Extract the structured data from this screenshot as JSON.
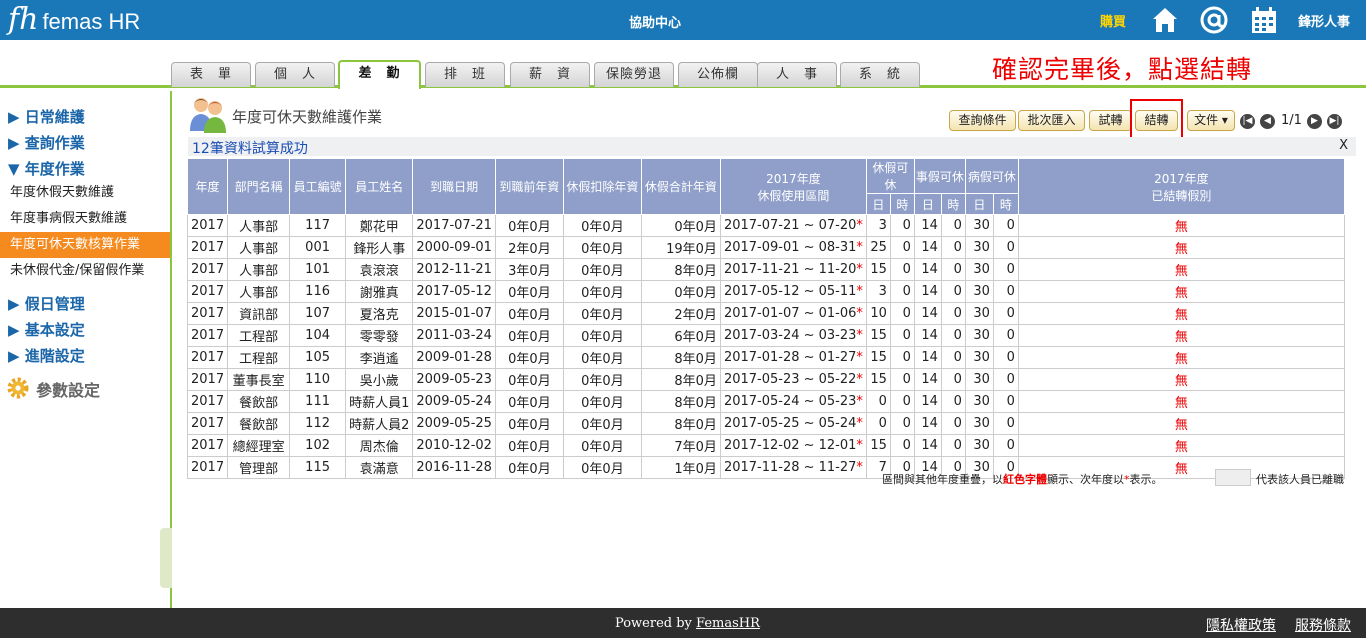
{
  "header": {
    "logo_mark": "fh",
    "logo_text": "femas HR",
    "center_title": "協助中心",
    "buy_label": "購買",
    "user_name": "鋒形人事"
  },
  "tabs": [
    "表　單",
    "個　人",
    "差　勤",
    "排　班",
    "薪　資",
    "保險勞退",
    "公佈欄",
    "人　事",
    "系　統"
  ],
  "annotation": "確認完畢後，點選結轉",
  "sidebar": {
    "groups": [
      "▶ 日常維護",
      "▶ 查詢作業",
      "▼ 年度作業",
      "▶ 假日管理",
      "▶ 基本設定",
      "▶ 進階設定"
    ],
    "items": [
      "年度休假天數維護",
      "年度事病假天數維護",
      "年度可休天數核算作業",
      "未休假代金/保留假作業"
    ],
    "param_label": "參數設定"
  },
  "page": {
    "title": "年度可休天數維護作業",
    "buttons": {
      "query": "查詢條件",
      "import": "批次匯入",
      "trial": "試轉",
      "carry": "結轉",
      "doc": "文件 ▾"
    },
    "pager": {
      "first": "|◀",
      "prev": "◀",
      "info": "1/1",
      "next": "▶",
      "last": "▶|"
    },
    "message": "12筆資料試算成功",
    "close": "X"
  },
  "table": {
    "headers": {
      "year": "年度",
      "dept": "部門名稱",
      "emp_no": "員工編號",
      "emp_name": "員工姓名",
      "join_date": "到職日期",
      "prior_years": "到職前年資",
      "leave_deduct": "休假扣除年資",
      "leave_total": "休假合計年資",
      "period_line1": "2017年度",
      "period_line2": "休假使用區間",
      "annual": "休假可休",
      "personal": "事假可休",
      "sick": "病假可休",
      "day": "日",
      "hour": "時",
      "carried_line1": "2017年度",
      "carried_line2": "已結轉假別"
    },
    "rows": [
      [
        "2017",
        "人事部",
        "117",
        "鄭花甲",
        "2017-07-21",
        "0年0月",
        "0年0月",
        "0年0月",
        "2017-07-21 ~ 07-20",
        "3",
        "0",
        "14",
        "0",
        "30",
        "0",
        "無"
      ],
      [
        "2017",
        "人事部",
        "001",
        "鋒形人事",
        "2000-09-01",
        "2年0月",
        "0年0月",
        "19年0月",
        "2017-09-01 ~ 08-31",
        "25",
        "0",
        "14",
        "0",
        "30",
        "0",
        "無"
      ],
      [
        "2017",
        "人事部",
        "101",
        "袁滾滾",
        "2012-11-21",
        "3年0月",
        "0年0月",
        "8年0月",
        "2017-11-21 ~ 11-20",
        "15",
        "0",
        "14",
        "0",
        "30",
        "0",
        "無"
      ],
      [
        "2017",
        "人事部",
        "116",
        "謝雅真",
        "2017-05-12",
        "0年0月",
        "0年0月",
        "0年0月",
        "2017-05-12 ~ 05-11",
        "3",
        "0",
        "14",
        "0",
        "30",
        "0",
        "無"
      ],
      [
        "2017",
        "資訊部",
        "107",
        "夏洛克",
        "2015-01-07",
        "0年0月",
        "0年0月",
        "2年0月",
        "2017-01-07 ~ 01-06",
        "10",
        "0",
        "14",
        "0",
        "30",
        "0",
        "無"
      ],
      [
        "2017",
        "工程部",
        "104",
        "零零發",
        "2011-03-24",
        "0年0月",
        "0年0月",
        "6年0月",
        "2017-03-24 ~ 03-23",
        "15",
        "0",
        "14",
        "0",
        "30",
        "0",
        "無"
      ],
      [
        "2017",
        "工程部",
        "105",
        "李逍遙",
        "2009-01-28",
        "0年0月",
        "0年0月",
        "8年0月",
        "2017-01-28 ~ 01-27",
        "15",
        "0",
        "14",
        "0",
        "30",
        "0",
        "無"
      ],
      [
        "2017",
        "董事長室",
        "110",
        "吳小歲",
        "2009-05-23",
        "0年0月",
        "0年0月",
        "8年0月",
        "2017-05-23 ~ 05-22",
        "15",
        "0",
        "14",
        "0",
        "30",
        "0",
        "無"
      ],
      [
        "2017",
        "餐飲部",
        "111",
        "時薪人員1",
        "2009-05-24",
        "0年0月",
        "0年0月",
        "8年0月",
        "2017-05-24 ~ 05-23",
        "0",
        "0",
        "14",
        "0",
        "30",
        "0",
        "無"
      ],
      [
        "2017",
        "餐飲部",
        "112",
        "時薪人員2",
        "2009-05-25",
        "0年0月",
        "0年0月",
        "8年0月",
        "2017-05-25 ~ 05-24",
        "0",
        "0",
        "14",
        "0",
        "30",
        "0",
        "無"
      ],
      [
        "2017",
        "總經理室",
        "102",
        "周杰倫",
        "2010-12-02",
        "0年0月",
        "0年0月",
        "7年0月",
        "2017-12-02 ~ 12-01",
        "15",
        "0",
        "14",
        "0",
        "30",
        "0",
        "無"
      ],
      [
        "2017",
        "管理部",
        "115",
        "袁滿意",
        "2016-11-28",
        "0年0月",
        "0年0月",
        "1年0月",
        "2017-11-28 ~ 11-27",
        "7",
        "0",
        "14",
        "0",
        "30",
        "0",
        "無"
      ]
    ]
  },
  "legend": {
    "part1": "區間與其他年度重疊，以",
    "red_word": "紅色字體",
    "part2": "顯示、次年度以",
    "star": "*",
    "part3": "表示。",
    "resigned": "代表該人員已離職"
  },
  "footer": {
    "powered_prefix": "Powered by ",
    "powered_brand": "FemasHR",
    "privacy": "隱私權政策",
    "terms": "服務條款"
  },
  "colors": {
    "header_blue": "#1b78b8",
    "accent_green": "#8cc63f",
    "active_orange": "#f58a1f",
    "table_header": "#8f9fc9",
    "highlight_red": "#e00000"
  }
}
